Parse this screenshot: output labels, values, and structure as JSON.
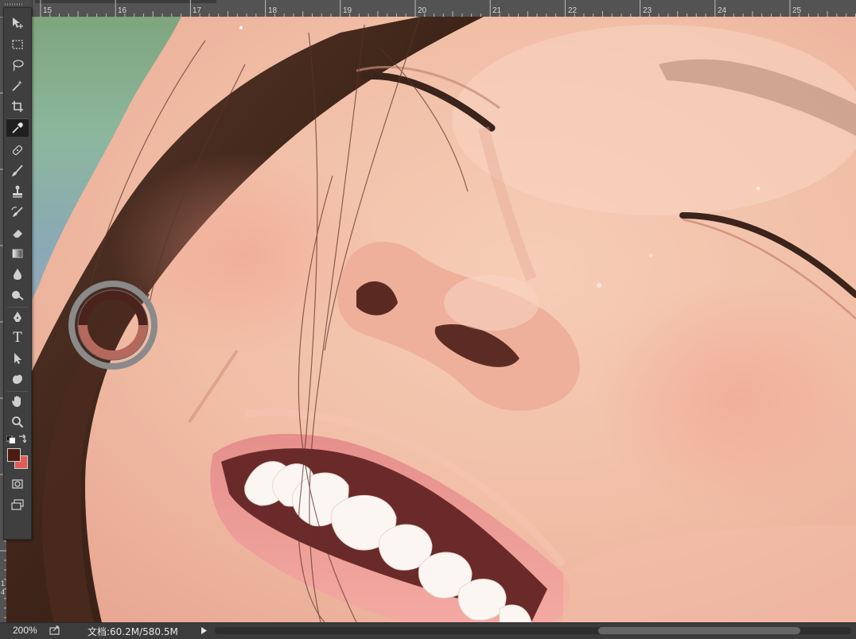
{
  "app": "Photoshop",
  "ruler_top": {
    "labels": [
      "15",
      "16",
      "17",
      "18",
      "19",
      "20",
      "21",
      "22",
      "23",
      "24",
      "25"
    ]
  },
  "ruler_left": {
    "labels": [
      "1",
      "4"
    ]
  },
  "toolbar": {
    "tools": [
      {
        "name": "move-tool",
        "icon": "move-icon"
      },
      {
        "name": "marquee-tool",
        "icon": "marquee-icon"
      },
      {
        "name": "lasso-tool",
        "icon": "lasso-icon"
      },
      {
        "name": "magic-wand-tool",
        "icon": "magic-wand-icon"
      },
      {
        "name": "crop-tool",
        "icon": "crop-icon"
      },
      {
        "name": "eyedropper-tool",
        "icon": "eyedropper-icon",
        "active": true
      },
      {
        "name": "healing-brush-tool",
        "icon": "bandage-icon"
      },
      {
        "name": "brush-tool",
        "icon": "brush-icon"
      },
      {
        "name": "clone-stamp-tool",
        "icon": "stamp-icon"
      },
      {
        "name": "history-brush-tool",
        "icon": "history-brush-icon"
      },
      {
        "name": "eraser-tool",
        "icon": "eraser-icon"
      },
      {
        "name": "gradient-tool",
        "icon": "gradient-icon"
      },
      {
        "name": "blur-tool",
        "icon": "blur-drop-icon"
      },
      {
        "name": "dodge-tool",
        "icon": "dodge-icon"
      },
      {
        "name": "pen-tool",
        "icon": "pen-icon"
      },
      {
        "name": "type-tool",
        "icon": "type-icon",
        "glyph": "T"
      },
      {
        "name": "path-selection-tool",
        "icon": "path-select-icon"
      },
      {
        "name": "custom-shape-tool",
        "icon": "shape-icon"
      },
      {
        "name": "hand-tool",
        "icon": "hand-icon"
      },
      {
        "name": "zoom-tool",
        "icon": "zoom-icon"
      }
    ],
    "foreground_color": "#4c1c12",
    "background_color": "#e25b57"
  },
  "eyedropper_loupe": {
    "top_color": "#4a241c",
    "bottom_color": "#b5685c",
    "ring_color": "#8a8a8a"
  },
  "status_bar": {
    "zoom": "200%",
    "doc_size": "文档:60.2M/580.5M"
  }
}
